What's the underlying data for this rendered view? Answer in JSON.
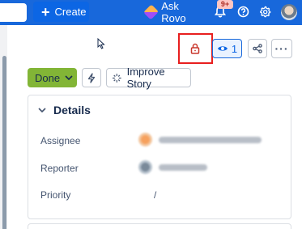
{
  "topbar": {
    "create_label": "Create",
    "rovo_label": "Ask Rovo",
    "notifications_badge": "9+"
  },
  "header_actions": {
    "watch_count": "1"
  },
  "status": {
    "current": "Done",
    "improve_label": "Improve Story"
  },
  "details": {
    "title": "Details",
    "fields": [
      {
        "label": "Assignee"
      },
      {
        "label": "Reporter"
      },
      {
        "label": "Priority",
        "value": "/"
      }
    ]
  },
  "colors": {
    "topbar": "#1868db",
    "done": "#82b536",
    "highlight": "#e81f1f"
  }
}
